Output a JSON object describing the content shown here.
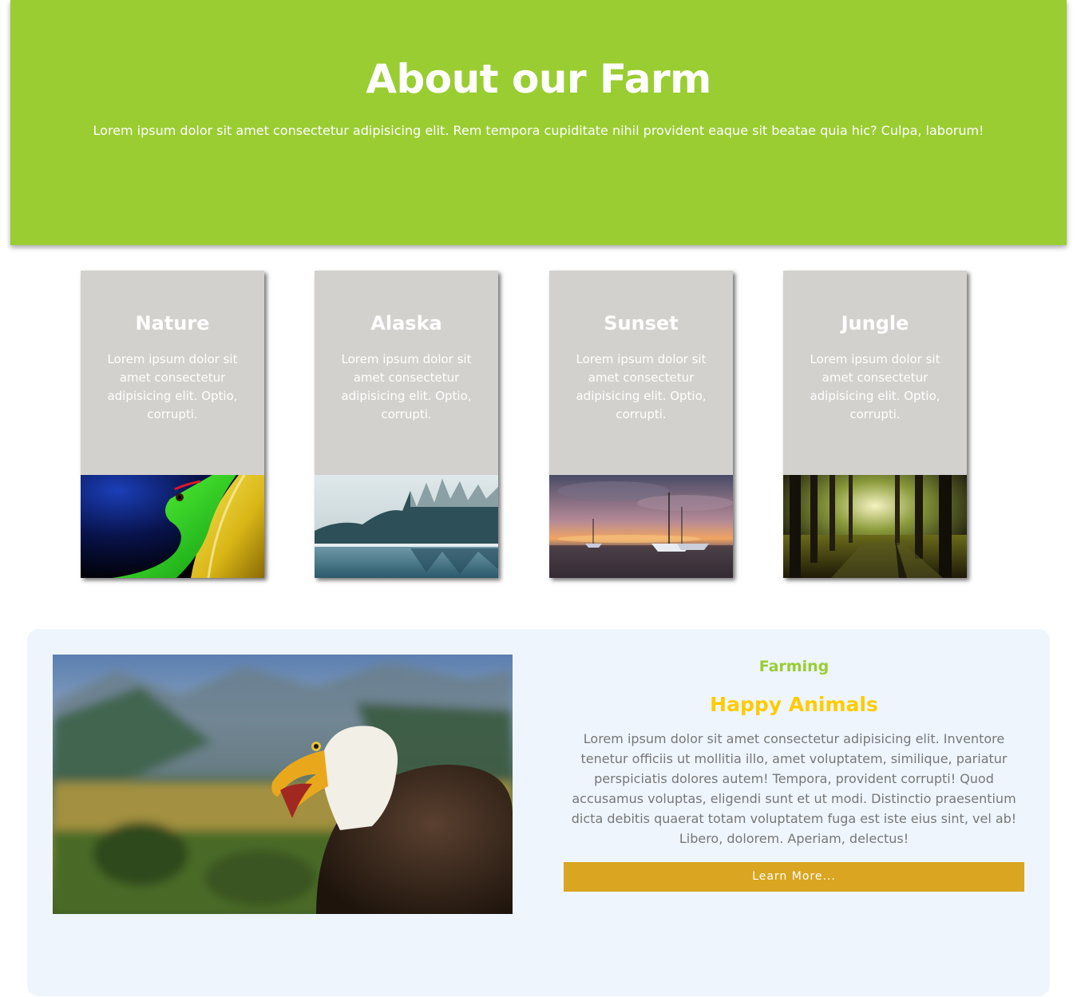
{
  "hero": {
    "title": "About our Farm",
    "subtitle": "Lorem ipsum dolor sit amet consectetur adipisicing elit. Rem tempora cupiditate nihil provident eaque sit beatae quia hic? Culpa, laborum!",
    "background": "#9acd32"
  },
  "cards": [
    {
      "title": "Nature",
      "text": "Lorem ipsum dolor sit amet consectetur adipisicing elit. Optio, corrupti.",
      "image": "green-gecko-photo"
    },
    {
      "title": "Alaska",
      "text": "Lorem ipsum dolor sit amet consectetur adipisicing elit. Optio, corrupti.",
      "image": "snowy-forest-lake-photo"
    },
    {
      "title": "Sunset",
      "text": "Lorem ipsum dolor sit amet consectetur adipisicing elit. Optio, corrupti.",
      "image": "sailboats-sunset-photo"
    },
    {
      "title": "Jungle",
      "text": "Lorem ipsum dolor sit amet consectetur adipisicing elit. Optio, corrupti.",
      "image": "forest-path-photo"
    }
  ],
  "feature": {
    "image": "bald-eagle-photo",
    "kicker": "Farming",
    "title": "Happy Animals",
    "body": "Lorem ipsum dolor sit amet consectetur adipisicing elit. Inventore tenetur officiis ut mollitia illo, amet voluptatem, similique, pariatur perspiciatis dolores autem! Tempora, provident corrupti! Quod accusamus voluptas, eligendi sunt et ut modi. Distinctio praesentium dicta debitis quaerat totam voluptatem fuga est iste eius sint, vel ab! Libero, dolorem. Aperiam, delectus!",
    "button_label": "Learn More...",
    "kicker_color": "#9acd32",
    "title_color": "#ffcc00",
    "button_color": "#daa520"
  }
}
